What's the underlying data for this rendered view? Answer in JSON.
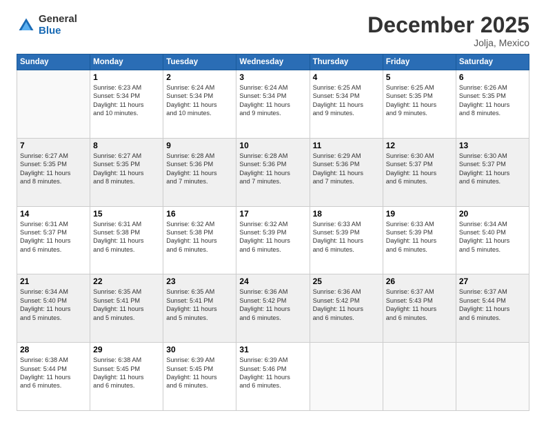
{
  "logo": {
    "general": "General",
    "blue": "Blue"
  },
  "title": "December 2025",
  "location": "Jolja, Mexico",
  "days_of_week": [
    "Sunday",
    "Monday",
    "Tuesday",
    "Wednesday",
    "Thursday",
    "Friday",
    "Saturday"
  ],
  "weeks": [
    [
      {
        "day": "",
        "info": ""
      },
      {
        "day": "1",
        "info": "Sunrise: 6:23 AM\nSunset: 5:34 PM\nDaylight: 11 hours\nand 10 minutes."
      },
      {
        "day": "2",
        "info": "Sunrise: 6:24 AM\nSunset: 5:34 PM\nDaylight: 11 hours\nand 10 minutes."
      },
      {
        "day": "3",
        "info": "Sunrise: 6:24 AM\nSunset: 5:34 PM\nDaylight: 11 hours\nand 9 minutes."
      },
      {
        "day": "4",
        "info": "Sunrise: 6:25 AM\nSunset: 5:34 PM\nDaylight: 11 hours\nand 9 minutes."
      },
      {
        "day": "5",
        "info": "Sunrise: 6:25 AM\nSunset: 5:35 PM\nDaylight: 11 hours\nand 9 minutes."
      },
      {
        "day": "6",
        "info": "Sunrise: 6:26 AM\nSunset: 5:35 PM\nDaylight: 11 hours\nand 8 minutes."
      }
    ],
    [
      {
        "day": "7",
        "info": "Sunrise: 6:27 AM\nSunset: 5:35 PM\nDaylight: 11 hours\nand 8 minutes."
      },
      {
        "day": "8",
        "info": "Sunrise: 6:27 AM\nSunset: 5:35 PM\nDaylight: 11 hours\nand 8 minutes."
      },
      {
        "day": "9",
        "info": "Sunrise: 6:28 AM\nSunset: 5:36 PM\nDaylight: 11 hours\nand 7 minutes."
      },
      {
        "day": "10",
        "info": "Sunrise: 6:28 AM\nSunset: 5:36 PM\nDaylight: 11 hours\nand 7 minutes."
      },
      {
        "day": "11",
        "info": "Sunrise: 6:29 AM\nSunset: 5:36 PM\nDaylight: 11 hours\nand 7 minutes."
      },
      {
        "day": "12",
        "info": "Sunrise: 6:30 AM\nSunset: 5:37 PM\nDaylight: 11 hours\nand 6 minutes."
      },
      {
        "day": "13",
        "info": "Sunrise: 6:30 AM\nSunset: 5:37 PM\nDaylight: 11 hours\nand 6 minutes."
      }
    ],
    [
      {
        "day": "14",
        "info": "Sunrise: 6:31 AM\nSunset: 5:37 PM\nDaylight: 11 hours\nand 6 minutes."
      },
      {
        "day": "15",
        "info": "Sunrise: 6:31 AM\nSunset: 5:38 PM\nDaylight: 11 hours\nand 6 minutes."
      },
      {
        "day": "16",
        "info": "Sunrise: 6:32 AM\nSunset: 5:38 PM\nDaylight: 11 hours\nand 6 minutes."
      },
      {
        "day": "17",
        "info": "Sunrise: 6:32 AM\nSunset: 5:39 PM\nDaylight: 11 hours\nand 6 minutes."
      },
      {
        "day": "18",
        "info": "Sunrise: 6:33 AM\nSunset: 5:39 PM\nDaylight: 11 hours\nand 6 minutes."
      },
      {
        "day": "19",
        "info": "Sunrise: 6:33 AM\nSunset: 5:39 PM\nDaylight: 11 hours\nand 6 minutes."
      },
      {
        "day": "20",
        "info": "Sunrise: 6:34 AM\nSunset: 5:40 PM\nDaylight: 11 hours\nand 5 minutes."
      }
    ],
    [
      {
        "day": "21",
        "info": "Sunrise: 6:34 AM\nSunset: 5:40 PM\nDaylight: 11 hours\nand 5 minutes."
      },
      {
        "day": "22",
        "info": "Sunrise: 6:35 AM\nSunset: 5:41 PM\nDaylight: 11 hours\nand 5 minutes."
      },
      {
        "day": "23",
        "info": "Sunrise: 6:35 AM\nSunset: 5:41 PM\nDaylight: 11 hours\nand 5 minutes."
      },
      {
        "day": "24",
        "info": "Sunrise: 6:36 AM\nSunset: 5:42 PM\nDaylight: 11 hours\nand 6 minutes."
      },
      {
        "day": "25",
        "info": "Sunrise: 6:36 AM\nSunset: 5:42 PM\nDaylight: 11 hours\nand 6 minutes."
      },
      {
        "day": "26",
        "info": "Sunrise: 6:37 AM\nSunset: 5:43 PM\nDaylight: 11 hours\nand 6 minutes."
      },
      {
        "day": "27",
        "info": "Sunrise: 6:37 AM\nSunset: 5:44 PM\nDaylight: 11 hours\nand 6 minutes."
      }
    ],
    [
      {
        "day": "28",
        "info": "Sunrise: 6:38 AM\nSunset: 5:44 PM\nDaylight: 11 hours\nand 6 minutes."
      },
      {
        "day": "29",
        "info": "Sunrise: 6:38 AM\nSunset: 5:45 PM\nDaylight: 11 hours\nand 6 minutes."
      },
      {
        "day": "30",
        "info": "Sunrise: 6:39 AM\nSunset: 5:45 PM\nDaylight: 11 hours\nand 6 minutes."
      },
      {
        "day": "31",
        "info": "Sunrise: 6:39 AM\nSunset: 5:46 PM\nDaylight: 11 hours\nand 6 minutes."
      },
      {
        "day": "",
        "info": ""
      },
      {
        "day": "",
        "info": ""
      },
      {
        "day": "",
        "info": ""
      }
    ]
  ]
}
